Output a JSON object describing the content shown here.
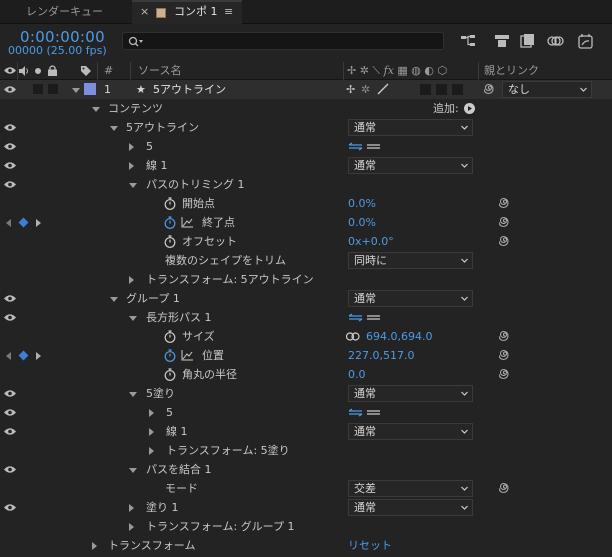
{
  "tabs": {
    "render_queue": "レンダーキュー",
    "comp": "コンポ 1"
  },
  "header": {
    "timecode": "0:00:00:00",
    "fps": "00000 (25.00 fps)"
  },
  "search": {
    "placeholder": ""
  },
  "columns": {
    "number": "#",
    "source_name": "ソース名",
    "parent_link": "親とリンク"
  },
  "layer": {
    "index": "1",
    "name": "5アウトライン",
    "parent": "なし"
  },
  "rows": {
    "contents": "コンテンツ",
    "add": "追加:",
    "outline": "5アウトライン",
    "outline_mode": "通常",
    "path5": "5",
    "stroke1": "線 1",
    "stroke1_mode": "通常",
    "trim": "パスのトリミング 1",
    "start": "開始点",
    "start_val": "0.0%",
    "end": "終了点",
    "end_val": "0.0%",
    "offset": "オフセット",
    "offset_val": "0x+0.0°",
    "trim_multi": "複数のシェイプをトリム",
    "trim_multi_val": "同時に",
    "transform_outline": "トランスフォーム: 5アウトライン",
    "group1": "グループ 1",
    "group1_mode": "通常",
    "rectpath": "長方形パス 1",
    "size": "サイズ",
    "size_val": "694.0,694.0",
    "position": "位置",
    "position_val": "227.0,517.0",
    "roundness": "角丸の半径",
    "roundness_val": "0.0",
    "fill5": "5塗り",
    "fill5_mode": "通常",
    "fill5_path": "5",
    "fill5_stroke": "線 1",
    "fill5_stroke_mode": "通常",
    "transform_fill": "トランスフォーム: 5塗り",
    "merge": "パスを結合 1",
    "mode": "モード",
    "mode_val": "交差",
    "fill1": "塗り 1",
    "fill1_mode": "通常",
    "transform_group": "トランスフォーム: グループ 1",
    "transform": "トランスフォーム",
    "reset": "リセット"
  },
  "colors": {
    "accent": "#4d9be6",
    "keyframe": "#3d7fd6",
    "label": "#7f8fe0"
  }
}
